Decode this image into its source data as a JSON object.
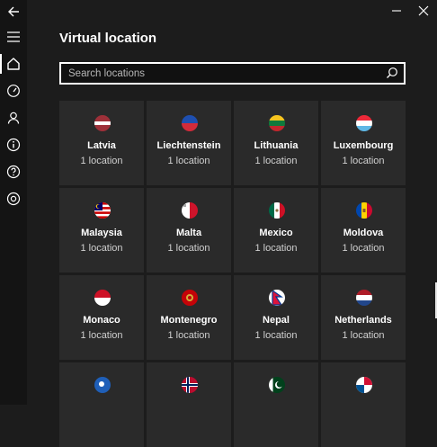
{
  "header": {
    "title": "Virtual location"
  },
  "search": {
    "placeholder": "Search locations",
    "value": ""
  },
  "nav": {
    "items": [
      {
        "name": "menu",
        "icon": "hamburger-menu-icon"
      },
      {
        "name": "home",
        "icon": "home-icon",
        "active": true
      },
      {
        "name": "speed",
        "icon": "speedometer-icon"
      },
      {
        "name": "account",
        "icon": "user-icon"
      },
      {
        "name": "info",
        "icon": "info-icon"
      },
      {
        "name": "help",
        "icon": "help-icon"
      },
      {
        "name": "settings",
        "icon": "gear-icon"
      }
    ]
  },
  "locations": [
    {
      "name": "Latvia",
      "count": "1 location"
    },
    {
      "name": "Liechtenstein",
      "count": "1 location"
    },
    {
      "name": "Lithuania",
      "count": "1 location"
    },
    {
      "name": "Luxembourg",
      "count": "1 location"
    },
    {
      "name": "Malaysia",
      "count": "1 location"
    },
    {
      "name": "Malta",
      "count": "1 location"
    },
    {
      "name": "Mexico",
      "count": "1 location"
    },
    {
      "name": "Moldova",
      "count": "1 location"
    },
    {
      "name": "Monaco",
      "count": "1 location"
    },
    {
      "name": "Montenegro",
      "count": "1 location"
    },
    {
      "name": "Nepal",
      "count": "1 location"
    },
    {
      "name": "Netherlands",
      "count": "1 location"
    },
    {
      "name": "",
      "count": ""
    },
    {
      "name": "",
      "count": ""
    },
    {
      "name": "",
      "count": ""
    },
    {
      "name": "",
      "count": ""
    }
  ],
  "colors": {
    "background": "#1c1c1c",
    "tile": "#2a2a2a",
    "sidebar": "#141414",
    "text": "#ffffff"
  }
}
